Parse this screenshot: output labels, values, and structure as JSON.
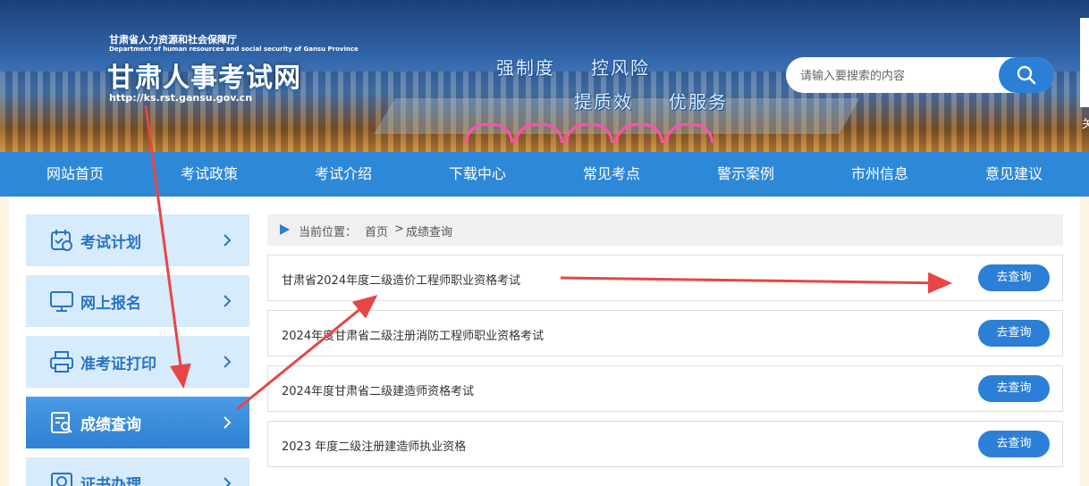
{
  "header": {
    "org_name_cn": "甘肃省人力资源和社会保障厅",
    "org_name_en": "Department of human resources and social security of Gansu Province",
    "site_title": "甘肃人事考试网",
    "site_url": "http://ks.rst.gansu.gov.cn",
    "slogans": [
      "强制度",
      "控风险",
      "提质效",
      "优服务"
    ],
    "edge_text": "关"
  },
  "search": {
    "placeholder": "请输入要搜索的内容",
    "icon": "search-icon"
  },
  "nav": {
    "items": [
      "网站首页",
      "考试政策",
      "考试介绍",
      "下载中心",
      "常见考点",
      "警示案例",
      "市州信息",
      "意见建议"
    ]
  },
  "sidebar": {
    "items": [
      {
        "label": "考试计划",
        "icon": "calendar-check-icon",
        "active": false
      },
      {
        "label": "网上报名",
        "icon": "monitor-icon",
        "active": false
      },
      {
        "label": "准考证打印",
        "icon": "printer-icon",
        "active": false
      },
      {
        "label": "成绩查询",
        "icon": "search-document-icon",
        "active": true
      },
      {
        "label": "证书办理",
        "icon": "certificate-icon",
        "active": false
      }
    ]
  },
  "breadcrumb": {
    "prefix": "当前位置：",
    "home": "首页",
    "separator": ">",
    "current": "成绩查询"
  },
  "results": {
    "button_label": "去查询",
    "items": [
      "甘肃省2024年度二级造价工程师职业资格考试",
      "2024年度甘肃省二级注册消防工程师职业资格考试",
      "2024年度甘肃省二级建造师资格考试",
      "2023 年度二级注册建造师执业资格"
    ]
  },
  "colors": {
    "primary": "#2e88d8",
    "button": "#2b7fd6",
    "sidebar_bg": "#d6ebfb",
    "annotation_arrow": "#e84545"
  }
}
